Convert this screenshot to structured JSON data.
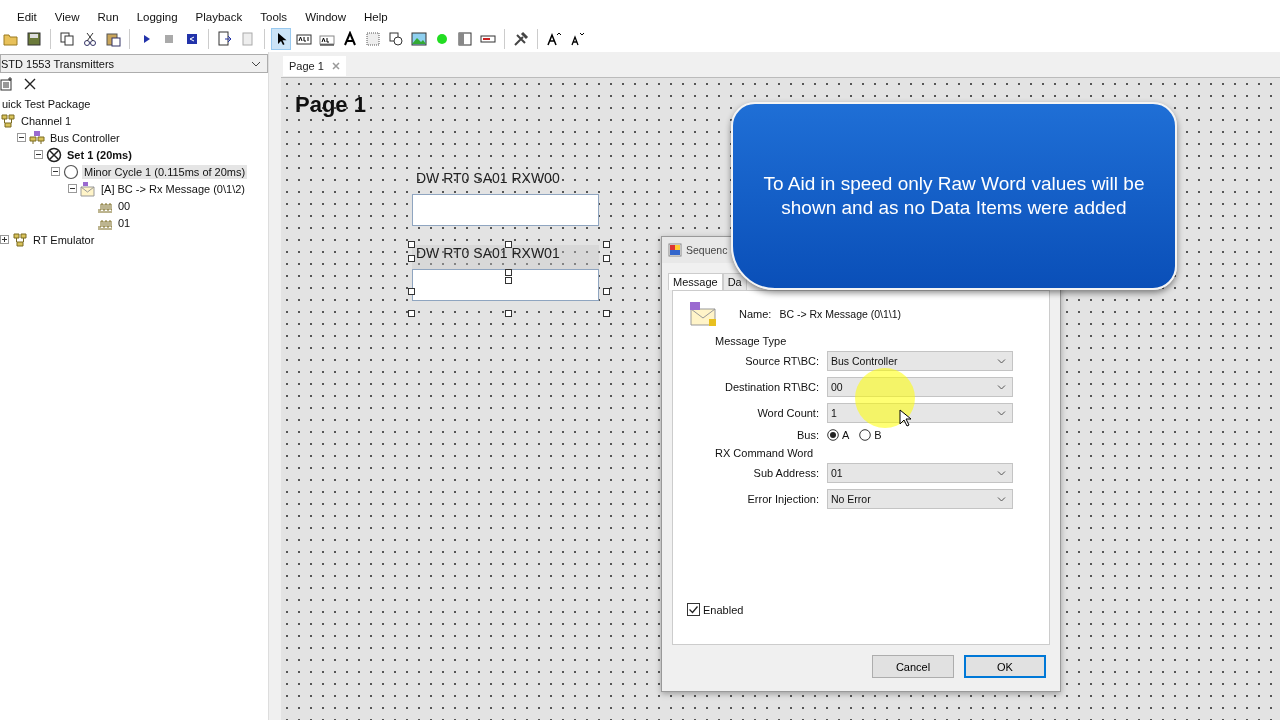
{
  "menu": [
    "Edit",
    "View",
    "Run",
    "Logging",
    "Playback",
    "Tools",
    "Window",
    "Help"
  ],
  "sidebar": {
    "dropdown": "STD 1553 Transmitters",
    "tree": [
      {
        "label": "uick Test Package",
        "bold": false,
        "selected": false,
        "children": [
          {
            "label": "Channel 1",
            "bold": false,
            "selected": false,
            "children": [
              {
                "label": "Bus Controller",
                "bold": false,
                "selected": false,
                "expanded": true,
                "children": [
                  {
                    "label": "Set 1 (20ms)",
                    "bold": true,
                    "selected": false,
                    "expanded": true,
                    "children": [
                      {
                        "label": "Minor Cycle 1 (0.115ms of 20ms)",
                        "bold": false,
                        "selected": true,
                        "expanded": true,
                        "children": [
                          {
                            "label": "[A] BC -> Rx Message (0\\1\\2)",
                            "bold": false,
                            "selected": false,
                            "expanded": true,
                            "children": [
                              {
                                "label": "00",
                                "bold": false,
                                "selected": false
                              },
                              {
                                "label": "01",
                                "bold": false,
                                "selected": false
                              }
                            ]
                          }
                        ]
                      }
                    ]
                  }
                ]
              }
            ]
          },
          {
            "label": "RT Emulator",
            "bold": false,
            "selected": false,
            "expanded": false
          }
        ]
      }
    ]
  },
  "tabs": [
    {
      "label": "Page 1",
      "selected": true
    }
  ],
  "page": {
    "title": "Page 1",
    "widgets": [
      {
        "label": "DW RT0 SA01 RXW00",
        "selected": false
      },
      {
        "label": "DW RT0 SA01 RXW01",
        "selected": true
      }
    ]
  },
  "callout": {
    "text": "To Aid in speed only Raw Word values will be shown and as no Data Items were added"
  },
  "dialog": {
    "title": "Sequenc",
    "tabs": [
      {
        "label": "Message",
        "selected": true
      },
      {
        "label": "Da",
        "selected": false
      }
    ],
    "name_label": "Name:",
    "name_value": "BC -> Rx Message (0\\1\\1)",
    "sections": [
      {
        "title": "Message Type",
        "rows": [
          {
            "kind": "select",
            "label": "Source RT\\BC:",
            "value": "Bus Controller"
          },
          {
            "kind": "select",
            "label": "Destination RT\\BC:",
            "value": "00"
          },
          {
            "kind": "select",
            "label": "Word Count:",
            "value": "1"
          },
          {
            "kind": "radio",
            "label": "Bus:",
            "options": [
              {
                "label": "A",
                "selected": true
              },
              {
                "label": "B",
                "selected": false
              }
            ]
          }
        ]
      },
      {
        "title": "RX Command Word",
        "rows": [
          {
            "kind": "select",
            "label": "Sub Address:",
            "value": "01"
          },
          {
            "kind": "select",
            "label": "Error Injection:",
            "value": "No Error"
          }
        ]
      }
    ],
    "enabled": {
      "label": "Enabled",
      "checked": true
    },
    "buttons": [
      {
        "label": "Cancel",
        "default": false
      },
      {
        "label": "OK",
        "default": true
      }
    ]
  }
}
